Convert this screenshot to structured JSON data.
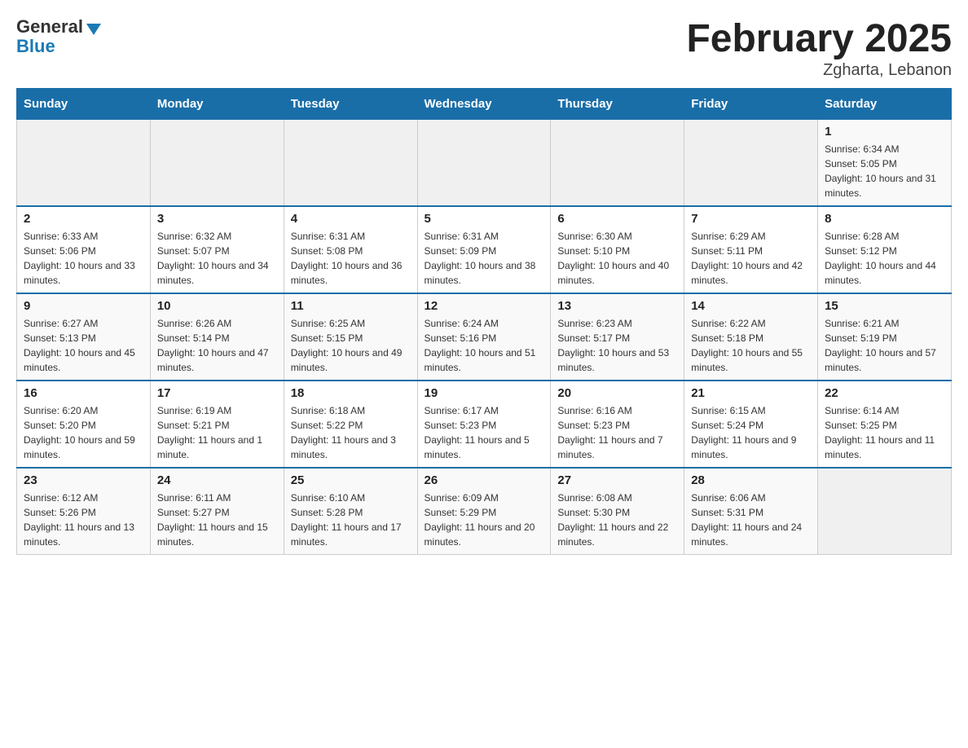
{
  "header": {
    "logo_general": "General",
    "logo_blue": "Blue",
    "title": "February 2025",
    "subtitle": "Zgharta, Lebanon"
  },
  "days_of_week": [
    "Sunday",
    "Monday",
    "Tuesday",
    "Wednesday",
    "Thursday",
    "Friday",
    "Saturday"
  ],
  "weeks": [
    {
      "days": [
        {
          "date": "",
          "info": ""
        },
        {
          "date": "",
          "info": ""
        },
        {
          "date": "",
          "info": ""
        },
        {
          "date": "",
          "info": ""
        },
        {
          "date": "",
          "info": ""
        },
        {
          "date": "",
          "info": ""
        },
        {
          "date": "1",
          "info": "Sunrise: 6:34 AM\nSunset: 5:05 PM\nDaylight: 10 hours and 31 minutes."
        }
      ]
    },
    {
      "days": [
        {
          "date": "2",
          "info": "Sunrise: 6:33 AM\nSunset: 5:06 PM\nDaylight: 10 hours and 33 minutes."
        },
        {
          "date": "3",
          "info": "Sunrise: 6:32 AM\nSunset: 5:07 PM\nDaylight: 10 hours and 34 minutes."
        },
        {
          "date": "4",
          "info": "Sunrise: 6:31 AM\nSunset: 5:08 PM\nDaylight: 10 hours and 36 minutes."
        },
        {
          "date": "5",
          "info": "Sunrise: 6:31 AM\nSunset: 5:09 PM\nDaylight: 10 hours and 38 minutes."
        },
        {
          "date": "6",
          "info": "Sunrise: 6:30 AM\nSunset: 5:10 PM\nDaylight: 10 hours and 40 minutes."
        },
        {
          "date": "7",
          "info": "Sunrise: 6:29 AM\nSunset: 5:11 PM\nDaylight: 10 hours and 42 minutes."
        },
        {
          "date": "8",
          "info": "Sunrise: 6:28 AM\nSunset: 5:12 PM\nDaylight: 10 hours and 44 minutes."
        }
      ]
    },
    {
      "days": [
        {
          "date": "9",
          "info": "Sunrise: 6:27 AM\nSunset: 5:13 PM\nDaylight: 10 hours and 45 minutes."
        },
        {
          "date": "10",
          "info": "Sunrise: 6:26 AM\nSunset: 5:14 PM\nDaylight: 10 hours and 47 minutes."
        },
        {
          "date": "11",
          "info": "Sunrise: 6:25 AM\nSunset: 5:15 PM\nDaylight: 10 hours and 49 minutes."
        },
        {
          "date": "12",
          "info": "Sunrise: 6:24 AM\nSunset: 5:16 PM\nDaylight: 10 hours and 51 minutes."
        },
        {
          "date": "13",
          "info": "Sunrise: 6:23 AM\nSunset: 5:17 PM\nDaylight: 10 hours and 53 minutes."
        },
        {
          "date": "14",
          "info": "Sunrise: 6:22 AM\nSunset: 5:18 PM\nDaylight: 10 hours and 55 minutes."
        },
        {
          "date": "15",
          "info": "Sunrise: 6:21 AM\nSunset: 5:19 PM\nDaylight: 10 hours and 57 minutes."
        }
      ]
    },
    {
      "days": [
        {
          "date": "16",
          "info": "Sunrise: 6:20 AM\nSunset: 5:20 PM\nDaylight: 10 hours and 59 minutes."
        },
        {
          "date": "17",
          "info": "Sunrise: 6:19 AM\nSunset: 5:21 PM\nDaylight: 11 hours and 1 minute."
        },
        {
          "date": "18",
          "info": "Sunrise: 6:18 AM\nSunset: 5:22 PM\nDaylight: 11 hours and 3 minutes."
        },
        {
          "date": "19",
          "info": "Sunrise: 6:17 AM\nSunset: 5:23 PM\nDaylight: 11 hours and 5 minutes."
        },
        {
          "date": "20",
          "info": "Sunrise: 6:16 AM\nSunset: 5:23 PM\nDaylight: 11 hours and 7 minutes."
        },
        {
          "date": "21",
          "info": "Sunrise: 6:15 AM\nSunset: 5:24 PM\nDaylight: 11 hours and 9 minutes."
        },
        {
          "date": "22",
          "info": "Sunrise: 6:14 AM\nSunset: 5:25 PM\nDaylight: 11 hours and 11 minutes."
        }
      ]
    },
    {
      "days": [
        {
          "date": "23",
          "info": "Sunrise: 6:12 AM\nSunset: 5:26 PM\nDaylight: 11 hours and 13 minutes."
        },
        {
          "date": "24",
          "info": "Sunrise: 6:11 AM\nSunset: 5:27 PM\nDaylight: 11 hours and 15 minutes."
        },
        {
          "date": "25",
          "info": "Sunrise: 6:10 AM\nSunset: 5:28 PM\nDaylight: 11 hours and 17 minutes."
        },
        {
          "date": "26",
          "info": "Sunrise: 6:09 AM\nSunset: 5:29 PM\nDaylight: 11 hours and 20 minutes."
        },
        {
          "date": "27",
          "info": "Sunrise: 6:08 AM\nSunset: 5:30 PM\nDaylight: 11 hours and 22 minutes."
        },
        {
          "date": "28",
          "info": "Sunrise: 6:06 AM\nSunset: 5:31 PM\nDaylight: 11 hours and 24 minutes."
        },
        {
          "date": "",
          "info": ""
        }
      ]
    }
  ]
}
